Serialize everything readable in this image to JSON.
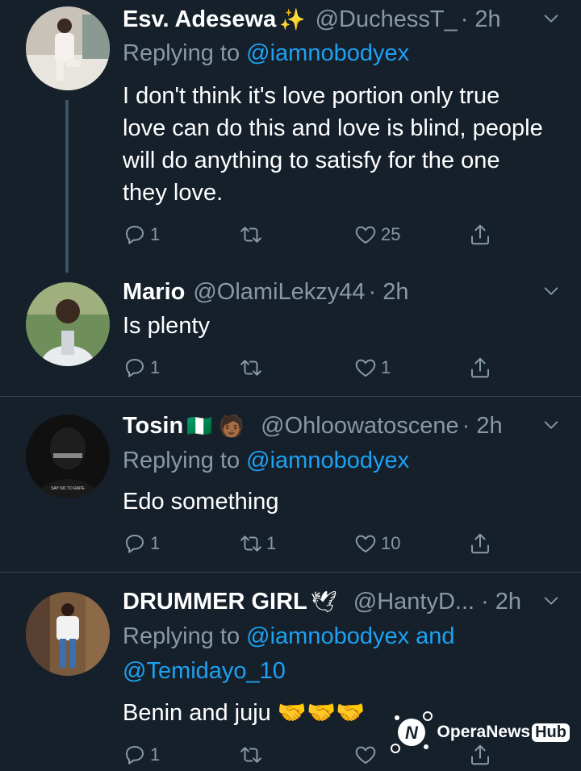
{
  "tweets": [
    {
      "name": "Esv. Adesewa",
      "name_emoji": "✨",
      "handle": "@DuchessT_",
      "time": "· 2h",
      "replying_prefix": "Replying to ",
      "replying_to": "@iamnobodyex",
      "text": "I don't think it's love portion only true love can do this and love is blind, people will do anything to satisfy for the one they love.",
      "replies": "1",
      "retweets": "",
      "likes": "25"
    },
    {
      "name": "Mario",
      "handle": "@OlamiLekzy44",
      "time": "· 2h",
      "text": "Is plenty",
      "replies": "1",
      "retweets": "",
      "likes": "1"
    },
    {
      "name": "Tosin",
      "name_emoji": "🇳🇬 🧑🏾",
      "handle": "@Ohloowatoscene",
      "time": "· 2h",
      "replying_prefix": "Replying to ",
      "replying_to": "@iamnobodyex",
      "text": "Edo something",
      "replies": "1",
      "retweets": "1",
      "likes": "10",
      "avatar_caption": "SAY NO TO RAPE"
    },
    {
      "name": "DRUMMER GIRL",
      "name_emoji": "🕊",
      "handle": "@HantyD...",
      "time": "· 2h",
      "replying_prefix": "Replying to ",
      "replying_to": "@iamnobodyex and",
      "replying_to_2": "@Temidayo_10",
      "text": "Benin and juju 🤝🤝🤝",
      "replies": "1",
      "retweets": "",
      "likes": ""
    }
  ],
  "watermark": {
    "brand": "OperaNews",
    "suffix": "Hub"
  },
  "colors": {
    "background": "#15202b",
    "secondary": "#8899a6",
    "link": "#1da1f2",
    "divider": "#38444d"
  },
  "icons": [
    "reply-icon",
    "retweet-icon",
    "like-icon",
    "share-icon",
    "chevron-down-icon"
  ]
}
